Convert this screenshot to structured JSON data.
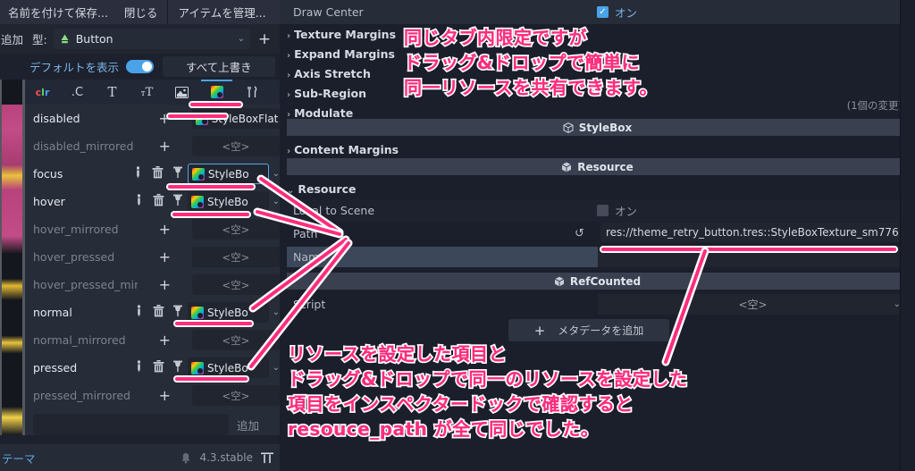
{
  "app": {
    "version": "4.3.stable",
    "bottom_tab": "テーマ"
  },
  "theme_editor": {
    "toolbar": {
      "save_as": "名前を付けて保存...",
      "close": "閉じる",
      "manage_items": "アイテムを管理..."
    },
    "type_row": {
      "add_label": "追加",
      "type_label": "型:",
      "type_value": "Button",
      "chevron": "⌄",
      "plus": "+"
    },
    "options_row": {
      "show_default_label": "デフォルトを表示",
      "show_default_on": true,
      "override_all": "すべて上書き"
    },
    "tabs": [
      {
        "name": "color-tab",
        "glyph": "clr",
        "selected": false
      },
      {
        "name": "constant-tab",
        "glyph": ".C",
        "selected": false
      },
      {
        "name": "font-tab",
        "glyph": "T",
        "selected": false
      },
      {
        "name": "font-size-tab",
        "glyph": "ᴛT",
        "selected": false
      },
      {
        "name": "icon-tab",
        "glyph": "▣",
        "selected": false
      },
      {
        "name": "stylebox-tab",
        "glyph": "◩",
        "selected": true
      },
      {
        "name": "tools-tab",
        "glyph": "⚒",
        "selected": false
      }
    ],
    "items": [
      {
        "name": "disabled",
        "state": "set",
        "value": "StyleBoxFlat",
        "icons": false
      },
      {
        "name": "disabled_mirrored",
        "state": "empty",
        "value": "<空>",
        "icons": false
      },
      {
        "name": "focus",
        "state": "set",
        "value": "StyleBo",
        "icons": true,
        "selected": true
      },
      {
        "name": "hover",
        "state": "set",
        "value": "StyleBo",
        "icons": true
      },
      {
        "name": "hover_mirrored",
        "state": "empty",
        "value": "<空>",
        "icons": false
      },
      {
        "name": "hover_pressed",
        "state": "empty",
        "value": "<空>",
        "icons": false
      },
      {
        "name": "hover_pressed_mirr",
        "state": "empty",
        "value": "<空>",
        "icons": false
      },
      {
        "name": "normal",
        "state": "set",
        "value": "StyleBo",
        "icons": true
      },
      {
        "name": "normal_mirrored",
        "state": "empty",
        "value": "<空>",
        "icons": false
      },
      {
        "name": "pressed",
        "state": "set",
        "value": "StyleBo",
        "icons": true
      },
      {
        "name": "pressed_mirrored",
        "state": "empty",
        "value": "<空>",
        "icons": false
      }
    ],
    "add_row": {
      "input_value": "",
      "button_label": "追加"
    }
  },
  "inspector": {
    "draw_center": {
      "label": "Draw Center",
      "checkbox_label": "オン",
      "checked": true
    },
    "groups": [
      {
        "label": "Texture Margins",
        "arrow": "›"
      },
      {
        "label": "Expand Margins",
        "arrow": "›"
      },
      {
        "label": "Axis Stretch",
        "arrow": "›"
      },
      {
        "label": "Sub-Region",
        "arrow": "›"
      },
      {
        "label": "Modulate",
        "arrow": "›"
      }
    ],
    "change_count": "(1個の変更)",
    "stylebox_section": "StyleBox",
    "content_margins": {
      "label": "Content Margins",
      "arrow": "›"
    },
    "resource_section": "Resource",
    "resource_group": {
      "label": "Resource",
      "arrow": "⌄"
    },
    "local_to_scene": {
      "label": "Local to Scene",
      "checkbox_label": "オン",
      "checked": false
    },
    "path": {
      "label": "Path",
      "value": "res://theme_retry_button.tres::StyleBoxTexture_sm776",
      "revert_icon": "revert-icon"
    },
    "name_field": {
      "label": "Name",
      "value": ""
    },
    "refcounted_section": "RefCounted",
    "script": {
      "label": "Script",
      "value": "<空>",
      "chevron": "⌄"
    },
    "add_metadata": {
      "plus": "+",
      "label": "メタデータを追加"
    }
  },
  "annotations": {
    "top": [
      "同じタブ内限定ですが",
      "ドラッグ&ドロップで簡単に",
      "同一リソースを共有できます。"
    ],
    "bottom": [
      "リソースを設定した項目と",
      "ドラッグ&ドロップで同一のリソースを設定した",
      "項目をインスペクタードックで確認すると",
      "resouce_path が全て同じでした。"
    ],
    "color": "#ff2d7e",
    "outline_color": "#ffffff"
  }
}
